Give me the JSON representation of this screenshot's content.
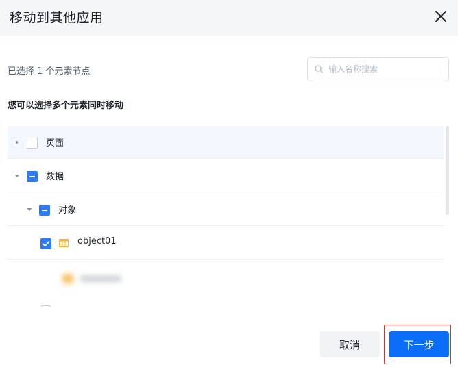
{
  "dialog": {
    "title": "移动到其他应用",
    "close_icon": "close-icon"
  },
  "selection": {
    "count_text": "已选择 1 个元素节点"
  },
  "search": {
    "placeholder": "输入名称搜索",
    "value": "",
    "icon": "search-icon"
  },
  "hint": {
    "text": "您可以选择多个元素同时移动"
  },
  "tree": {
    "nodes": [
      {
        "label": "页面",
        "state": "unchecked",
        "expanded": false,
        "level": 0
      },
      {
        "label": "数据",
        "state": "indeterminate",
        "expanded": true,
        "level": 0
      },
      {
        "label": "对象",
        "state": "indeterminate",
        "expanded": true,
        "level": 1
      },
      {
        "label": "object01",
        "state": "checked",
        "icon": "table-icon",
        "level": 2
      }
    ]
  },
  "footer": {
    "cancel_label": "取消",
    "next_label": "下一步"
  },
  "colors": {
    "primary": "#0b6cf8",
    "checkbox": "#2f7bf5",
    "table_icon": "#f5b23d",
    "highlight_border": "#d9322b"
  }
}
